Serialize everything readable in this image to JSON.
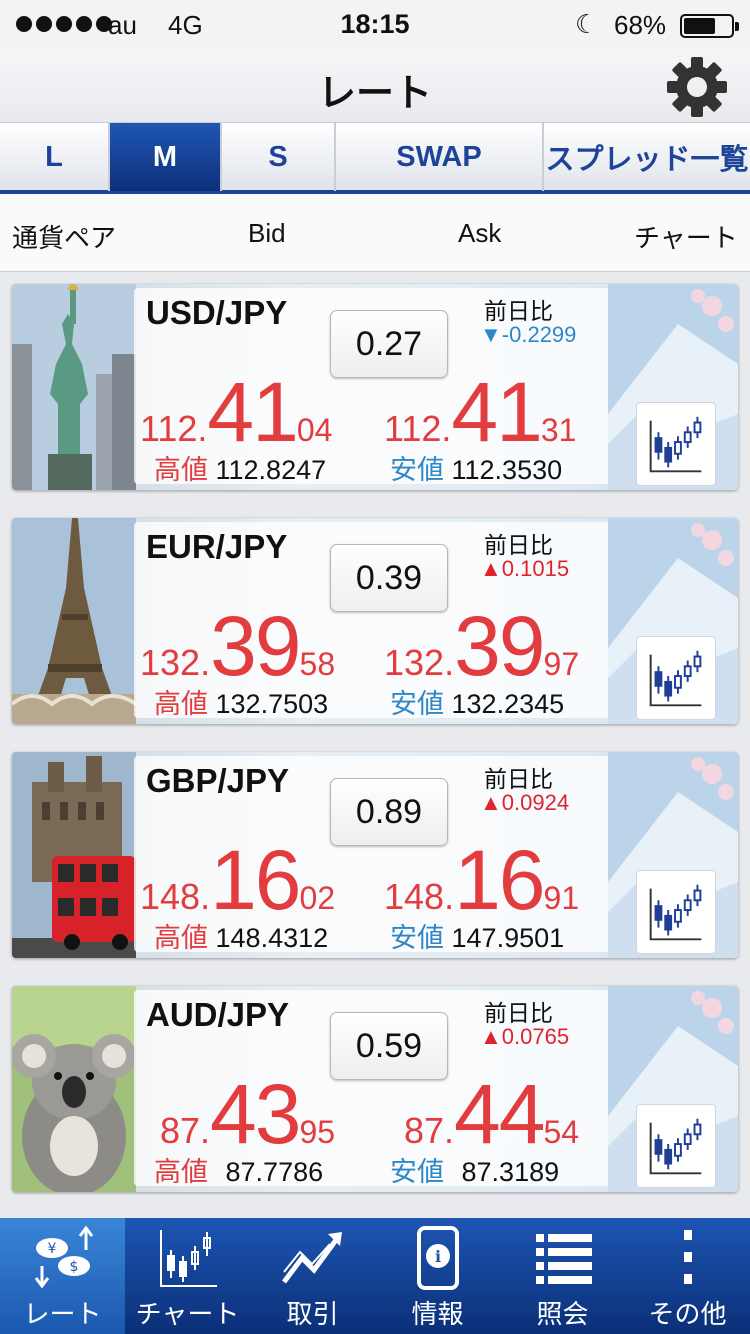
{
  "status_bar": {
    "carrier": "au",
    "network": "4G",
    "time": "18:15",
    "battery": "68%",
    "battery_level": 0.68
  },
  "header": {
    "title": "レート",
    "settings_icon": "gear-icon"
  },
  "tabs": [
    {
      "label": "L",
      "active": false
    },
    {
      "label": "M",
      "active": true
    },
    {
      "label": "S",
      "active": false
    },
    {
      "label": "SWAP",
      "active": false
    },
    {
      "label": "スプレッド一覧",
      "active": false
    }
  ],
  "columns": {
    "pair": "通貨ペア",
    "bid": "Bid",
    "ask": "Ask",
    "chart": "チャート"
  },
  "labels": {
    "change": "前日比",
    "high": "高値",
    "low": "安値"
  },
  "colors": {
    "accent": "#1c4599",
    "price_red": "#e23c3e",
    "change_down_blue": "#2e87c7",
    "change_up_red": "#e0242d"
  },
  "rates": [
    {
      "pair": "USD/JPY",
      "spread": "0.27",
      "change": "-0.2299",
      "direction": "down",
      "change_arrow": "▼",
      "bid": {
        "pre": "112.",
        "big": "41",
        "suf": "04"
      },
      "ask": {
        "pre": "112.",
        "big": "41",
        "suf": "31"
      },
      "high": "112.8247",
      "low": "112.3530",
      "photo": "statue-of-liberty"
    },
    {
      "pair": "EUR/JPY",
      "spread": "0.39",
      "change": "0.1015",
      "direction": "up",
      "change_arrow": "▲",
      "bid": {
        "pre": "132.",
        "big": "39",
        "suf": "58"
      },
      "ask": {
        "pre": "132.",
        "big": "39",
        "suf": "97"
      },
      "high": "132.7503",
      "low": "132.2345",
      "photo": "eiffel-tower"
    },
    {
      "pair": "GBP/JPY",
      "spread": "0.89",
      "change": "0.0924",
      "direction": "up",
      "change_arrow": "▲",
      "bid": {
        "pre": "148.",
        "big": "16",
        "suf": "02"
      },
      "ask": {
        "pre": "148.",
        "big": "16",
        "suf": "91"
      },
      "high": "148.4312",
      "low": "147.9501",
      "photo": "london-bus"
    },
    {
      "pair": "AUD/JPY",
      "spread": "0.59",
      "change": "0.0765",
      "direction": "up",
      "change_arrow": "▲",
      "bid": {
        "pre": "87.",
        "big": "43",
        "suf": "95"
      },
      "ask": {
        "pre": "87.",
        "big": "44",
        "suf": "54"
      },
      "high": "87.7786",
      "low": "87.3189",
      "photo": "koala"
    }
  ],
  "bottom_nav": [
    {
      "label": "レート",
      "icon": "rate-exchange-icon",
      "active": true
    },
    {
      "label": "チャート",
      "icon": "candlestick-chart-icon",
      "active": false
    },
    {
      "label": "取引",
      "icon": "trade-trend-icon",
      "active": false
    },
    {
      "label": "情報",
      "icon": "info-phone-icon",
      "active": false
    },
    {
      "label": "照会",
      "icon": "list-icon",
      "active": false
    },
    {
      "label": "その他",
      "icon": "more-icon",
      "active": false
    }
  ]
}
